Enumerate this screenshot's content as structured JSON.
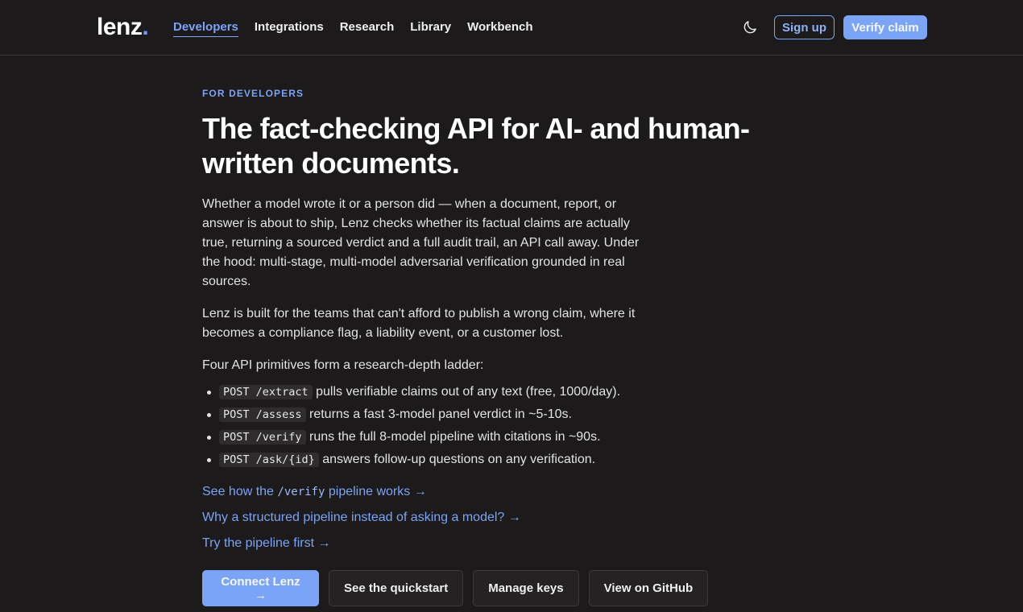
{
  "header": {
    "logo_text": "lenz",
    "logo_dot": ".",
    "nav": [
      {
        "label": "Developers",
        "active": true
      },
      {
        "label": "Integrations",
        "active": false
      },
      {
        "label": "Research",
        "active": false
      },
      {
        "label": "Library",
        "active": false
      },
      {
        "label": "Workbench",
        "active": false
      }
    ],
    "theme_icon": "moon-icon",
    "signup_label": "Sign up",
    "verify_label": "Verify claim"
  },
  "main": {
    "eyebrow": "FOR DEVELOPERS",
    "title": "The fact-checking API for AI- and human-written documents.",
    "para1": "Whether a model wrote it or a person did — when a document, report, or answer is about to ship, Lenz checks whether its factual claims are actually true, returning a sourced verdict and a full audit trail, an API call away. Under the hood: multi-stage, multi-model adversarial verification grounded in real sources.",
    "para2": "Lenz is built for the teams that can't afford to publish a wrong claim, where it becomes a compliance flag, a liability event, or a customer lost.",
    "para3": "Four API primitives form a research-depth ladder:",
    "primitives": [
      {
        "code": "POST /extract",
        "text": " pulls verifiable claims out of any text (free, 1000/day)."
      },
      {
        "code": "POST /assess",
        "text": " returns a fast 3-model panel verdict in ~5-10s."
      },
      {
        "code": "POST /verify",
        "text": " runs the full 8-model pipeline with citations in ~90s."
      },
      {
        "code": "POST /ask/{id}",
        "text": " answers follow-up questions on any verification."
      }
    ],
    "links": {
      "link1_pre": "See how the ",
      "link1_code": "/verify",
      "link1_post": " pipeline works →",
      "link2": "Why a structured pipeline instead of asking a model? →",
      "link3": "Try the pipeline first →"
    },
    "actions": {
      "connect": "Connect Lenz →",
      "quickstart": "See the quickstart",
      "keys": "Manage keys",
      "github": "View on GitHub"
    }
  },
  "colors": {
    "background": "#1c1a1a",
    "accent": "#7ba4f6",
    "text": "#ececec"
  }
}
